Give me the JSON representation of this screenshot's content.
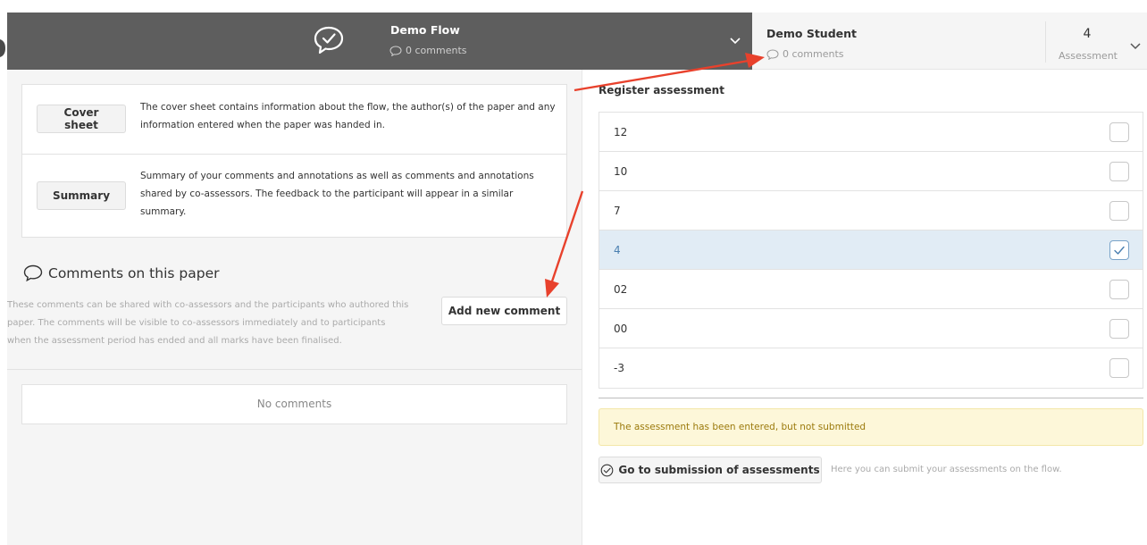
{
  "header": {
    "flow_title": "Demo Flow",
    "flow_comments": "0 comments",
    "student_name": "Demo Student",
    "student_comments": "0 comments",
    "grade_value": "4",
    "grade_label": "Assessment"
  },
  "left": {
    "cover_sheet_button": "Cover sheet",
    "cover_sheet_text": "The cover sheet contains information about the flow, the author(s) of the paper and any information entered when the paper was handed in.",
    "summary_button": "Summary",
    "summary_text": "Summary of your comments and annotations as well as comments and annotations shared by co-assessors. The feedback to the participant will appear in a similar summary.",
    "comments_title": "Comments on this paper",
    "comments_desc": "These comments can be shared with co-assessors and the participants who authored this paper. The comments will be visible to co-assessors immediately and to participants when the assessment period has ended and all marks have been finalised.",
    "add_comment_button": "Add new comment",
    "no_comments": "No comments"
  },
  "right": {
    "register_title": "Register assessment",
    "grades": [
      {
        "label": "12",
        "checked": false
      },
      {
        "label": "10",
        "checked": false
      },
      {
        "label": "7",
        "checked": false
      },
      {
        "label": "4",
        "checked": true
      },
      {
        "label": "02",
        "checked": false
      },
      {
        "label": "00",
        "checked": false
      },
      {
        "label": "-3",
        "checked": false
      }
    ],
    "warning": "The assessment has been entered, but not submitted",
    "submit_button": "Go to submission of assessments",
    "submit_hint": "Here you can submit your assessments on the flow."
  },
  "colors": {
    "header_dark": "#5e5e5e",
    "selected_row": "#e1ecf5",
    "annotation_arrow": "#e8412c",
    "warning_bg": "#fdf7d9"
  }
}
